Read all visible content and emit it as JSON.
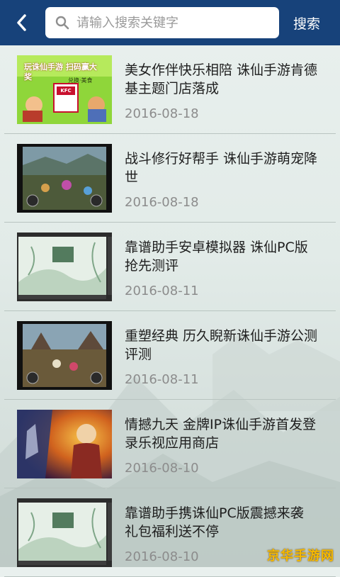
{
  "header": {
    "search_placeholder": "请输入搜索关键字",
    "search_label": "搜索"
  },
  "items": [
    {
      "title": "美女作伴快乐相陪 诛仙手游肯德基主题门店落成",
      "date": "2016-08-18",
      "thumb": {
        "caption": "玩诛仙手游 扫码赢大奖",
        "subcaption": "兑换·美食",
        "badge": "KFC"
      }
    },
    {
      "title": "战斗修行好帮手 诛仙手游萌宠降世",
      "date": "2016-08-18"
    },
    {
      "title": "靠谱助手安卓模拟器 诛仙PC版抢先测评",
      "date": "2016-08-11"
    },
    {
      "title": "重塑经典 历久睨新诛仙手游公测评测",
      "date": "2016-08-11"
    },
    {
      "title": "情撼九天 金牌IP诛仙手游首发登录乐视应用商店",
      "date": "2016-08-10"
    },
    {
      "title": "靠谱助手携诛仙PC版震撼来袭 礼包福利送不停",
      "date": "2016-08-10"
    }
  ],
  "watermark": "京华手游网",
  "colors": {
    "header": "#17427a",
    "date": "#8c8c8c",
    "watermark": "#f5b800"
  }
}
